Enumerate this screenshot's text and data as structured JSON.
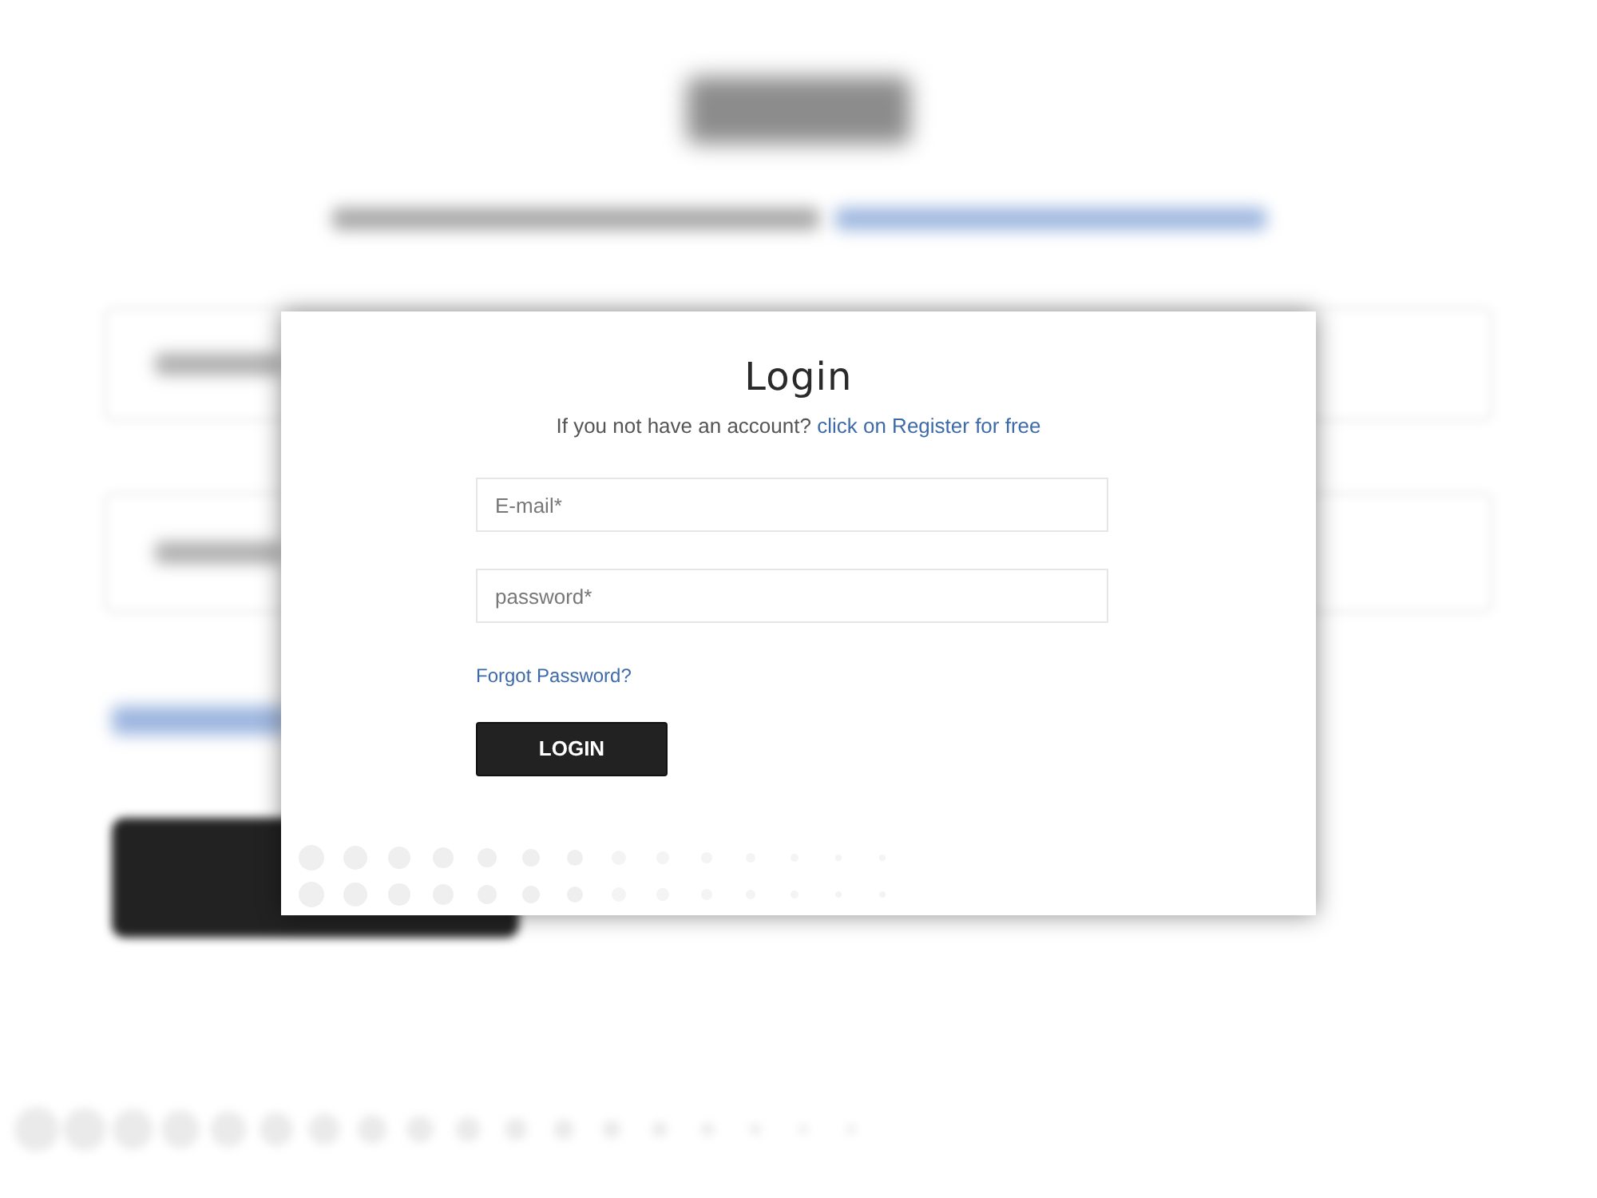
{
  "modal": {
    "title": "Login",
    "prompt": {
      "text": "If you not have an account?",
      "link": "click on Register for free"
    },
    "fields": [
      {
        "placeholder": "E-mail*"
      },
      {
        "placeholder": "password*"
      }
    ],
    "forgot_link": "Forgot Password?",
    "submit_button": "LOGIN"
  }
}
